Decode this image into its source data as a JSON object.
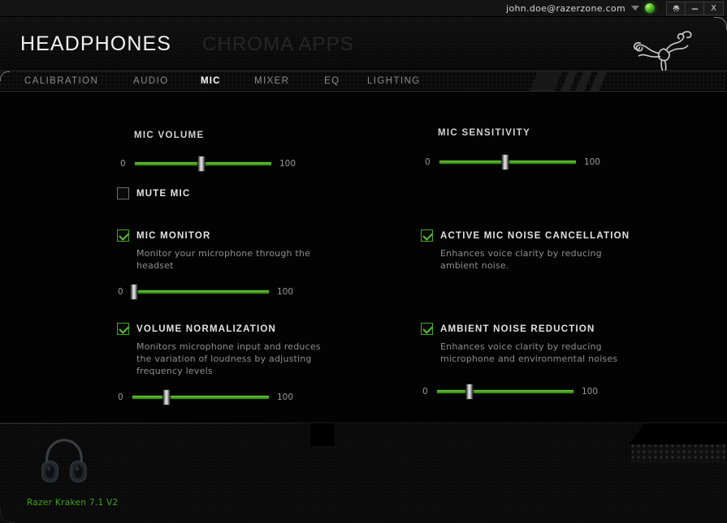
{
  "titlebar": {
    "account": "john.doe@razerzone.com",
    "caret_icon": "chevron-down-icon",
    "status_icon": "online-status-orb",
    "settings_label": "⚙",
    "minimize_label": "–",
    "close_label": "X"
  },
  "header": {
    "title": "HEADPHONES",
    "secondary_title": "CHROMA APPS",
    "logo_icon": "razer-triple-snake-logo"
  },
  "tabs": [
    {
      "id": "calibration",
      "label": "CALIBRATION",
      "active": false
    },
    {
      "id": "audio",
      "label": "AUDIO",
      "active": false
    },
    {
      "id": "mic",
      "label": "MIC",
      "active": true
    },
    {
      "id": "mixer",
      "label": "MIXER",
      "active": false
    },
    {
      "id": "eq",
      "label": "EQ",
      "active": false
    },
    {
      "id": "lighting",
      "label": "LIGHTING",
      "active": false
    }
  ],
  "controls": {
    "mic_volume": {
      "label": "MIC VOLUME",
      "min_label": "0",
      "max_label": "100",
      "value": 49
    },
    "mute_mic": {
      "label": "MUTE MIC",
      "checked": false
    },
    "mic_monitor": {
      "label": "MIC MONITOR",
      "description": "Monitor your microphone through the headset",
      "checked": true,
      "min_label": "0",
      "max_label": "100",
      "value": 1
    },
    "volume_normalization": {
      "label": "VOLUME NORMALIZATION",
      "description": "Monitors microphone input and reduces the variation of loudness by adjusting frequency levels",
      "checked": true,
      "min_label": "0",
      "max_label": "100",
      "value": 25
    },
    "mic_sensitivity": {
      "label": "MIC SENSITIVITY",
      "min_label": "0",
      "max_label": "100",
      "value": 48
    },
    "active_mic_noise_cancellation": {
      "label": "ACTIVE MIC NOISE CANCELLATION",
      "description": "Enhances voice clarity by reducing ambient noise.",
      "checked": true
    },
    "ambient_noise_reduction": {
      "label": "AMBIENT NOISE REDUCTION",
      "description": "Enhances voice clarity by reducing microphone and environmental noises",
      "checked": true,
      "min_label": "0",
      "max_label": "100",
      "value": 24
    }
  },
  "footer": {
    "device_name": "Razer Kraken 7.1 V2",
    "device_icon": "headphones-icon"
  },
  "colors": {
    "accent_green": "#4aa81e",
    "device_name_green": "#3fa41c",
    "window_bg": "#050505",
    "panel_bg": "#0a0a0a"
  }
}
